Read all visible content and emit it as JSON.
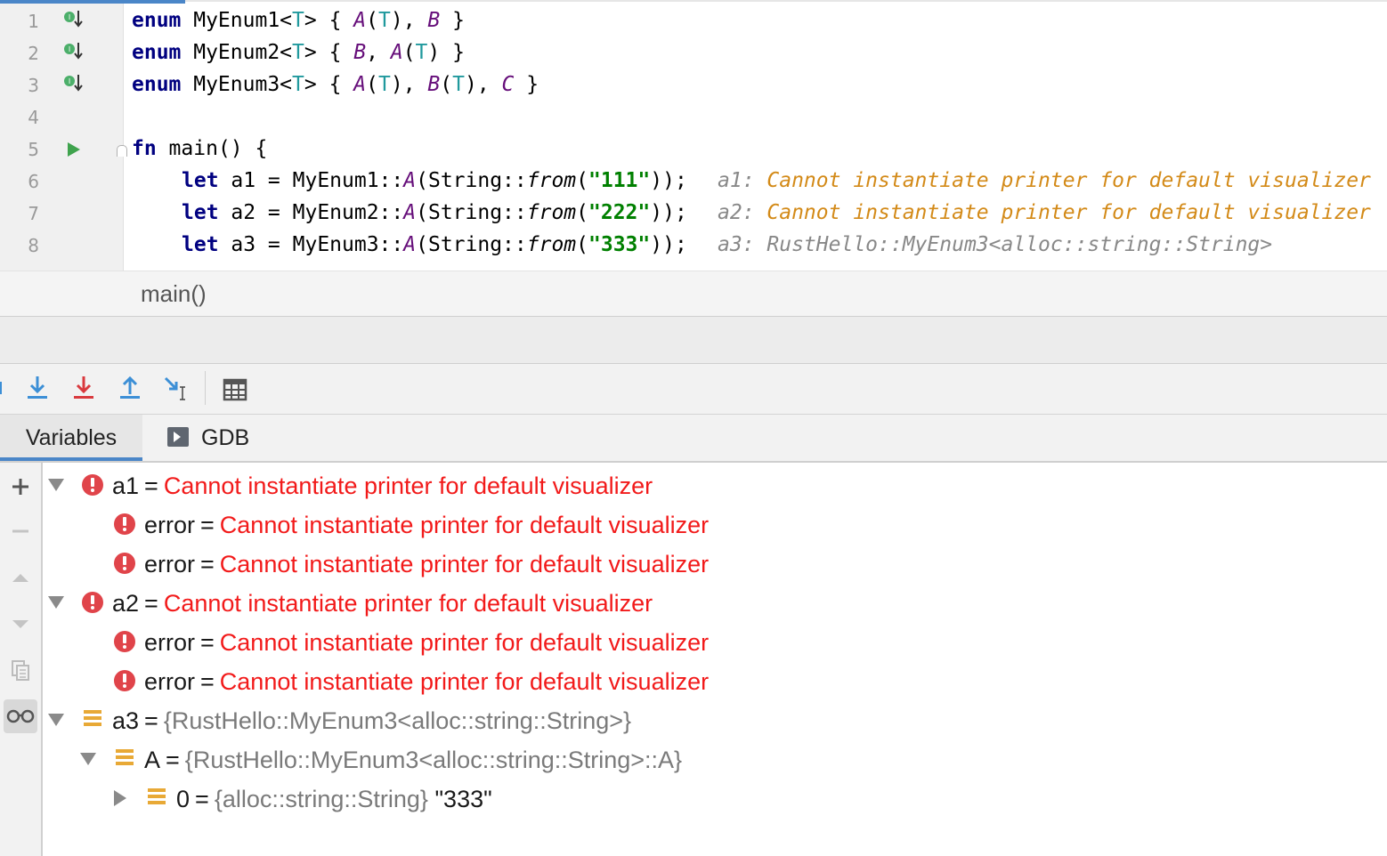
{
  "editor": {
    "line_numbers": [
      "1",
      "2",
      "3",
      "4",
      "5",
      "6",
      "7",
      "8"
    ],
    "lines": {
      "l1": {
        "kw": "enum",
        "name": " MyEnum1<",
        "t": "T",
        ">": "> { ",
        "v1": "A",
        "p1": "(",
        "t1": "T",
        "p2": "), ",
        "v2": "B",
        "end": " }"
      },
      "l2": {
        "kw": "enum",
        "name": " MyEnum2<",
        "t": "T",
        ">": "> { ",
        "v1": "B",
        "p1": ", ",
        "v2": "A",
        "p2": "(",
        "t1": "T",
        "end": ") }"
      },
      "l3": {
        "kw": "enum",
        "name": " MyEnum3<",
        "t": "T",
        ">": "> { ",
        "v1": "A",
        "p1": "(",
        "t1": "T",
        "p2": "), ",
        "v2": "B",
        "p3": "(",
        "t2": "T",
        "p4": "), ",
        "v3": "C",
        "end": " }"
      },
      "l5": {
        "kw": "fn",
        "rest": " main() {"
      },
      "l6": {
        "kw": "let",
        "a": " a1 = MyEnum1::",
        "v": "A",
        "b": "(String::",
        "f": "from",
        "c": "(",
        "s": "\"111\"",
        "d": "));"
      },
      "l7": {
        "kw": "let",
        "a": " a2 = MyEnum2::",
        "v": "A",
        "b": "(String::",
        "f": "from",
        "c": "(",
        "s": "\"222\"",
        "d": "));"
      },
      "l8": {
        "kw": "let",
        "a": " a3 = MyEnum3::",
        "v": "A",
        "b": "(String::",
        "f": "from",
        "c": "(",
        "s": "\"333\"",
        "d": "));"
      }
    },
    "hints": {
      "h6": {
        "name": "a1: ",
        "msg": "Cannot instantiate printer for default visualizer"
      },
      "h7": {
        "name": "a2: ",
        "msg": "Cannot instantiate printer for default visualizer"
      },
      "h8": {
        "name": "a3: ",
        "msg": "RustHello::MyEnum3<alloc::string::String>"
      }
    },
    "breadcrumb": "main()"
  },
  "toolbar": {
    "buttons": [
      "step-over-icon",
      "step-into-icon",
      "force-step-into-icon",
      "step-out-icon",
      "run-to-cursor-icon",
      "evaluate-expression-icon"
    ]
  },
  "tabs": {
    "variables": "Variables",
    "gdb": "GDB"
  },
  "variables": {
    "eq": "=",
    "a1": {
      "name": "a1",
      "value": "Cannot instantiate printer for default visualizer"
    },
    "a1_err1": {
      "name": "error",
      "value": "Cannot instantiate printer for default visualizer"
    },
    "a1_err2": {
      "name": "error",
      "value": "Cannot instantiate printer for default visualizer"
    },
    "a2": {
      "name": "a2",
      "value": "Cannot instantiate printer for default visualizer"
    },
    "a2_err1": {
      "name": "error",
      "value": "Cannot instantiate printer for default visualizer"
    },
    "a2_err2": {
      "name": "error",
      "value": "Cannot instantiate printer for default visualizer"
    },
    "a3": {
      "name": "a3",
      "type": "{RustHello::MyEnum3<alloc::string::String>}"
    },
    "a3_A": {
      "name": "A",
      "type": "{RustHello::MyEnum3<alloc::string::String>::A}"
    },
    "a3_A_0": {
      "name": "0",
      "type": "{alloc::string::String}",
      "value": "\"333\""
    }
  },
  "colors": {
    "error": "#f21a1a",
    "keyword": "#000080",
    "string": "#008000",
    "hint_warning": "#d38a18",
    "accent": "#4a86c8"
  }
}
